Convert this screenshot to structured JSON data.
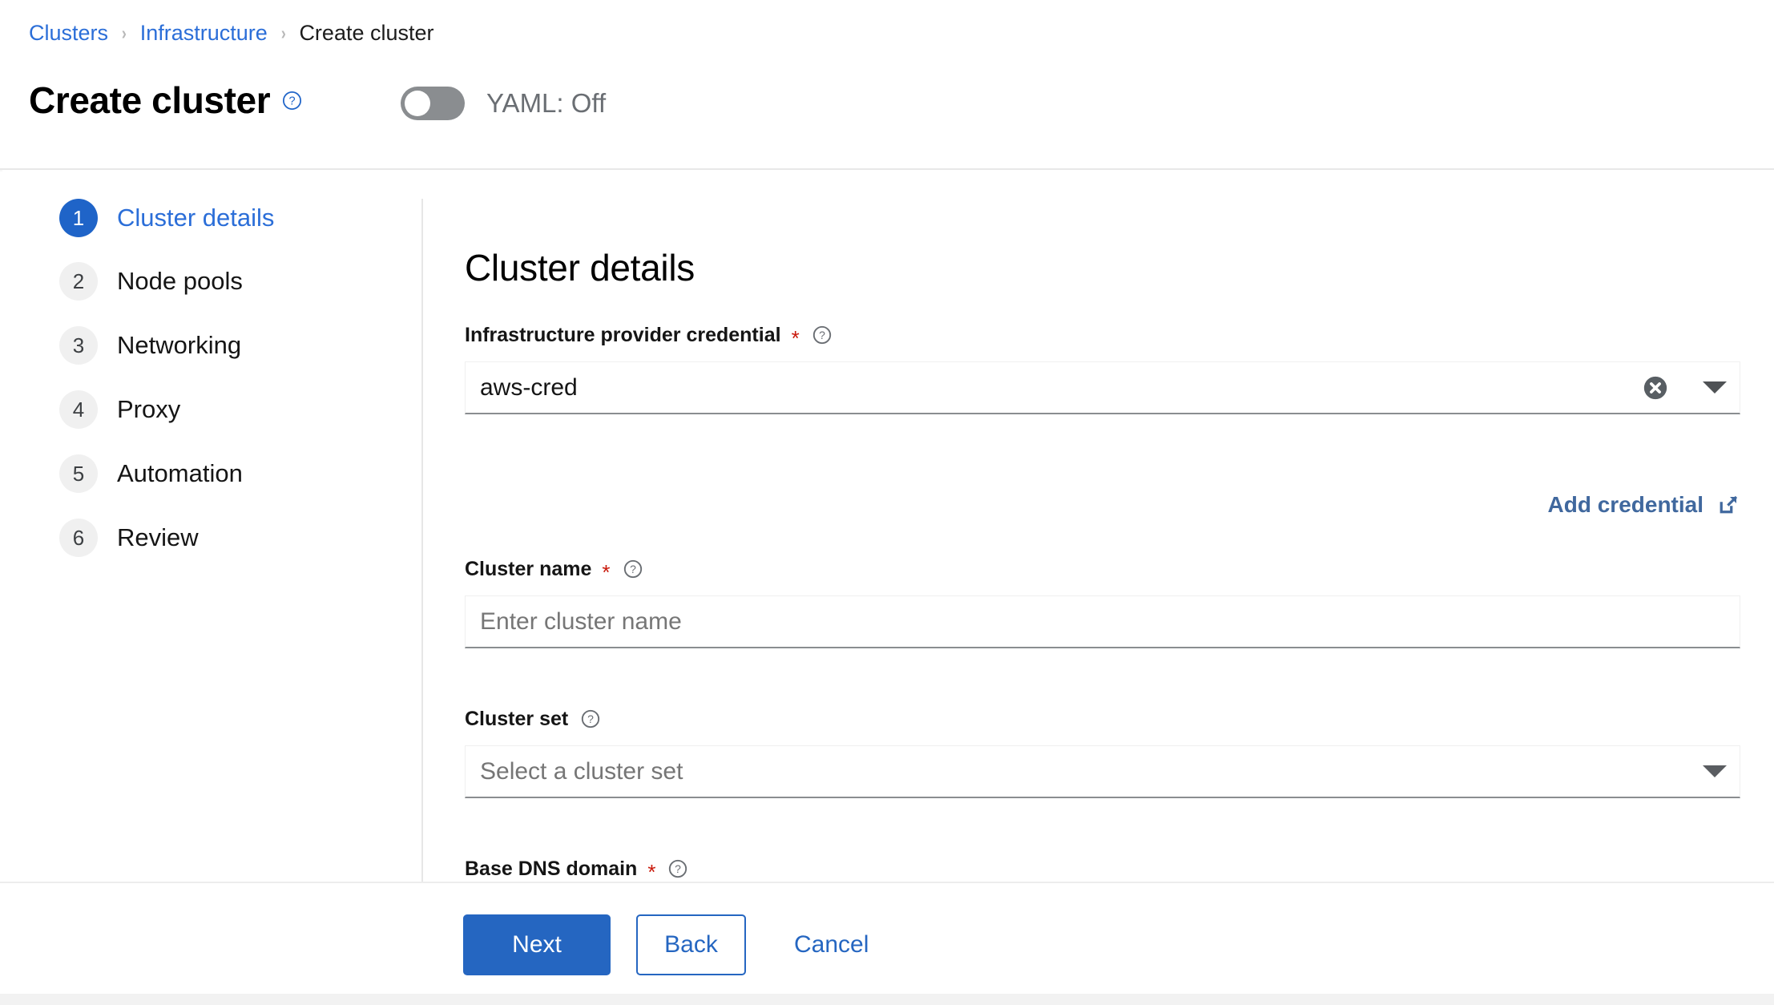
{
  "breadcrumb": {
    "items": [
      {
        "label": "Clusters",
        "type": "link"
      },
      {
        "label": "Infrastructure",
        "type": "link"
      },
      {
        "label": "Create cluster",
        "type": "current"
      }
    ],
    "separator": "›"
  },
  "header": {
    "title": "Create cluster",
    "help_icon": "question-circle-icon",
    "yaml_toggle": {
      "label": "YAML: Off",
      "state": "off"
    }
  },
  "wizard": {
    "steps": [
      {
        "num": "1",
        "label": "Cluster details",
        "active": true
      },
      {
        "num": "2",
        "label": "Node pools",
        "active": false
      },
      {
        "num": "3",
        "label": "Networking",
        "active": false
      },
      {
        "num": "4",
        "label": "Proxy",
        "active": false
      },
      {
        "num": "5",
        "label": "Automation",
        "active": false
      },
      {
        "num": "6",
        "label": "Review",
        "active": false
      }
    ]
  },
  "form": {
    "section_title": "Cluster details",
    "fields": {
      "credential": {
        "label": "Infrastructure provider credential",
        "required": true,
        "required_marker": "*",
        "value": "aws-cred",
        "clear_icon": "clear-circle-icon",
        "caret_icon": "chevron-down-icon",
        "help_icon": "question-circle-icon"
      },
      "add_credential": {
        "label": "Add credential",
        "icon": "external-link-icon"
      },
      "cluster_name": {
        "label": "Cluster name",
        "required": true,
        "required_marker": "*",
        "placeholder": "Enter cluster name",
        "value": "",
        "help_icon": "question-circle-icon"
      },
      "cluster_set": {
        "label": "Cluster set",
        "required": false,
        "placeholder": "Select a cluster set",
        "value": "",
        "caret_icon": "chevron-down-icon",
        "help_icon": "question-circle-icon"
      },
      "base_dns_domain": {
        "label": "Base DNS domain",
        "required": true,
        "required_marker": "*",
        "help_icon": "question-circle-icon"
      }
    }
  },
  "footer": {
    "next_label": "Next",
    "back_label": "Back",
    "cancel_label": "Cancel"
  },
  "colors": {
    "accent_blue": "#2566c1",
    "link_blue": "#2b6ed8",
    "required_red": "#c9190b",
    "muted_gray": "#6a6e73"
  }
}
